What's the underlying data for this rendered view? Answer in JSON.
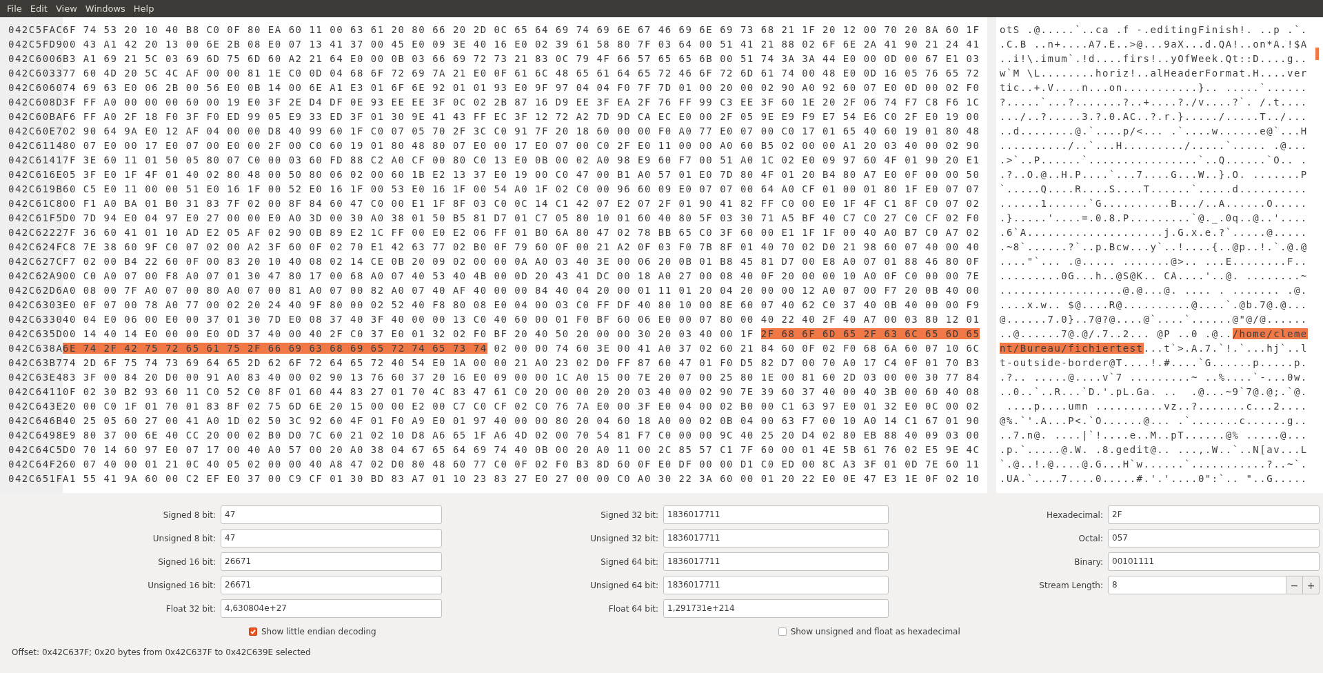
{
  "menu": [
    "File",
    "Edit",
    "View",
    "Windows",
    "Help"
  ],
  "rows": [
    {
      "offset": "042C5FAC",
      "hex": [
        {
          "text": "6F 74 53 20 10 40 B8 C0 0F 80 EA 60 11 00 63 61 20 80 66 20 2D 0C 65 64 69 74 69 6E 67 46 69 6E 69 73 68 21 1F 20 12 00 70 20 8A 60 1F",
          "selected": false
        }
      ],
      "ascii": [
        {
          "text": "otS .@.....`..ca .f -.editingFinish!. ..p .`.",
          "selected": false
        }
      ]
    },
    {
      "offset": "042C5FD9",
      "hex": [
        {
          "text": "00 43 A1 42 20 13 00 6E 2B 08 E0 07 13 41 37 00 45 E0 09 3E 40 16 E0 02 39 61 58 80 7F 03 64 00 51 41 21 88 02 6F 6E 2A 41 90 21 24 41",
          "selected": false
        }
      ],
      "ascii": [
        {
          "text": ".C.B ..n+....A7.E..>@...9aX...d.QA!..on*A.!$A",
          "selected": false
        }
      ]
    },
    {
      "offset": "042C6006",
      "hex": [
        {
          "text": "B3 A1 69 21 5C 03 69 6D 75 6D 60 A2 21 64 E0 00 0B 03 66 69 72 73 21 83 0C 79 4F 66 57 65 65 6B 00 51 74 3A 3A 44 E0 00 0D 00 67 E1 03",
          "selected": false
        }
      ],
      "ascii": [
        {
          "text": "..i!\\.imum`.!d....firs!..yOfWeek.Qt::D....g..",
          "selected": false
        }
      ]
    },
    {
      "offset": "042C6033",
      "hex": [
        {
          "text": "77 60 4D 20 5C 4C AF 00 00 81 1E C0 0D 04 68 6F 72 69 7A 21 E0 0F 61 6C 48 65 61 64 65 72 46 6F 72 6D 61 74 00 48 E0 0D 16 05 76 65 72",
          "selected": false
        }
      ],
      "ascii": [
        {
          "text": "w`M \\L........horiz!..alHeaderFormat.H....ver",
          "selected": false
        }
      ]
    },
    {
      "offset": "042C6060",
      "hex": [
        {
          "text": "74 69 63 E0 06 2B 00 56 E0 0B 14 00 6E A1 E3 01 6F 6E 92 01 01 93 E0 9F 97 04 04 F0 7F 7D 01 00 20 00 02 90 A0 92 60 07 E0 0D 00 02 F0",
          "selected": false
        }
      ],
      "ascii": [
        {
          "text": "tic..+.V....n...on...........}.. .....`......",
          "selected": false
        }
      ]
    },
    {
      "offset": "042C608D",
      "hex": [
        {
          "text": "3F FF A0 00 00 00 60 00 19 E0 3F 2E D4 DF 0E 93 EE EE 3F 0C 02 2B 87 16 D9 EE 3F EA 2F 76 FF 99 C3 EE 3F 60 1E 20 2F 06 74 F7 C8 F6 1C",
          "selected": false
        }
      ],
      "ascii": [
        {
          "text": "?.....`...?.......?..+....?./v....?`. /.t....",
          "selected": false
        }
      ]
    },
    {
      "offset": "042C60BA",
      "hex": [
        {
          "text": "F6 FF A0 2F 18 F0 3F F0 ED 99 05 E9 33 ED 3F 01 30 9E 41 43 FF EC 3F 12 72 A2 7D 9D CA EC E0 00 2F 05 9E E9 F9 E7 54 E6 C0 2F E0 19 00",
          "selected": false
        }
      ],
      "ascii": [
        {
          "text": ".../..?.....3.?.0.AC..?.r.}...../.....T../...",
          "selected": false
        }
      ]
    },
    {
      "offset": "042C60E7",
      "hex": [
        {
          "text": "02 90 64 9A E0 12 AF 04 00 00 D8 40 99 60 1F C0 07 05 70 2F 3C C0 91 7F 20 18 60 00 00 F0 A0 77 E0 07 00 C0 17 01 65 40 60 19 01 80 48",
          "selected": false
        }
      ],
      "ascii": [
        {
          "text": "..d........@.`....p/<... .`....w......e@`...H",
          "selected": false
        }
      ]
    },
    {
      "offset": "042C6114",
      "hex": [
        {
          "text": "80 07 E0 00 17 E0 07 00 E0 00 2F 00 C0 60 19 01 80 48 80 07 E0 00 17 E0 07 00 C0 2F E0 11 00 00 A0 60 B5 02 00 00 A1 20 03 40 00 02 90",
          "selected": false
        }
      ],
      "ascii": [
        {
          "text": "........../..`...H........./.....`..... .@...",
          "selected": false
        }
      ]
    },
    {
      "offset": "042C6141",
      "hex": [
        {
          "text": "7F 3E 60 11 01 50 05 80 07 C0 00 03 60 FD 88 C2 A0 CF 00 80 C0 13 E0 0B 00 02 A0 98 E9 60 F7 00 51 A0 1C 02 E0 09 97 60 4F 01 90 20 E1",
          "selected": false
        }
      ],
      "ascii": [
        {
          "text": ".>`..P......`................`..Q......`O.. .",
          "selected": false
        }
      ]
    },
    {
      "offset": "042C616E",
      "hex": [
        {
          "text": "05 3F E0 1F 4F 01 40 02 80 48 00 50 80 06 02 00 60 1B E2 13 37 E0 19 00 C0 47 00 B1 A0 57 01 E0 7D 80 4F 01 20 B4 80 A7 E0 0F 00 00 50",
          "selected": false
        }
      ],
      "ascii": [
        {
          "text": ".?..O.@..H.P....`...7....G...W..}.O. .......P",
          "selected": false
        }
      ]
    },
    {
      "offset": "042C619B",
      "hex": [
        {
          "text": "60 C5 E0 11 00 00 51 E0 16 1F 00 52 E0 16 1F 00 53 E0 16 1F 00 54 A0 1F 02 C0 00 96 60 09 E0 07 07 00 64 A0 CF 01 00 01 80 1F E0 07 07",
          "selected": false
        }
      ],
      "ascii": [
        {
          "text": "`.....Q....R....S....T......`.....d..........",
          "selected": false
        }
      ]
    },
    {
      "offset": "042C61C8",
      "hex": [
        {
          "text": "00 F1 A0 BA 01 B0 31 83 7F 02 00 8F 84 60 47 C0 00 E1 1F 8F 03 C0 0C 14 C1 42 07 E2 07 2F 01 90 41 82 FF C0 00 E0 1F 4F C1 8F C0 07 02",
          "selected": false
        }
      ],
      "ascii": [
        {
          "text": "......1......`G..........B.../..A......O.....",
          "selected": false
        }
      ]
    },
    {
      "offset": "042C61F5",
      "hex": [
        {
          "text": "D0 7D 94 E0 04 97 E0 27 00 00 E0 A0 3D 00 30 A0 38 01 50 B5 81 D7 01 C7 05 80 10 01 60 40 80 5F 03 30 71 A5 BF 40 C7 C0 27 C0 CF 02 F0",
          "selected": false
        }
      ],
      "ascii": [
        {
          "text": ".}.....'....=.0.8.P.........`@._.0q..@..'....",
          "selected": false
        }
      ]
    },
    {
      "offset": "042C6222",
      "hex": [
        {
          "text": "7F 36 60 41 01 10 AD E2 05 AF 02 90 0B 89 E2 1C FF 00 E0 E2 06 FF 01 B0 6A 80 47 02 78 BB 65 C0 3F 60 00 E1 1F 1F 00 40 A0 B7 C0 A7 02",
          "selected": false
        }
      ],
      "ascii": [
        {
          "text": ".6`A....................j.G.x.e.?`.....@.....",
          "selected": false
        }
      ]
    },
    {
      "offset": "042C624F",
      "hex": [
        {
          "text": "C8 7E 38 60 9F C0 07 02 00 A2 3F 60 0F 02 70 E1 42 63 77 02 B0 0F 79 60 0F 00 21 A2 0F 03 F0 7B 8F 01 40 70 02 D0 21 98 60 07 40 00 40",
          "selected": false
        }
      ],
      "ascii": [
        {
          "text": ".~8`......?`..p.Bcw...y`..!....{..@p..!.`.@.@",
          "selected": false
        }
      ]
    },
    {
      "offset": "042C627C",
      "hex": [
        {
          "text": "F7 02 00 B4 22 60 0F 00 83 20 10 40 08 02 14 CE 0B 20 09 02 00 00 0A A0 03 40 3E 00 06 20 0B 01 B8 45 81 D7 00 E8 A0 07 01 88 46 80 0F",
          "selected": false
        }
      ],
      "ascii": [
        {
          "text": "....\"`... .@..... .......@>.. ...E........F..",
          "selected": false
        }
      ]
    },
    {
      "offset": "042C62A9",
      "hex": [
        {
          "text": "00 C0 A0 07 00 F8 A0 07 01 30 47 80 17 00 68 A0 07 40 53 40 4B 00 0D 20 43 41 DC 00 18 A0 27 00 08 40 0F 20 00 00 10 A0 0F C0 00 00 7E",
          "selected": false
        }
      ],
      "ascii": [
        {
          "text": ".........0G...h..@S@K.. CA....'..@. ........~",
          "selected": false
        }
      ]
    },
    {
      "offset": "042C62D6",
      "hex": [
        {
          "text": "A0 08 00 7F A0 07 00 80 A0 07 00 81 A0 07 00 82 A0 07 40 AF 40 00 00 84 40 04 20 00 01 11 01 20 04 20 00 00 12 A0 07 00 F7 20 0B 40 00",
          "selected": false
        }
      ],
      "ascii": [
        {
          "text": "..................@.@...@. .... . ....... .@.",
          "selected": false
        }
      ]
    },
    {
      "offset": "042C6303",
      "hex": [
        {
          "text": "E0 0F 07 00 78 A0 77 00 02 20 24 40 9F 80 00 02 52 40 F8 80 08 E0 04 00 03 C0 FF DF 40 80 10 00 8E 60 07 40 62 C0 37 40 0B 40 00 00 F9",
          "selected": false
        }
      ],
      "ascii": [
        {
          "text": "....x.w.. $@....R@..........@....`.@b.7@.@...",
          "selected": false
        }
      ]
    },
    {
      "offset": "042C6330",
      "hex": [
        {
          "text": "40 04 E0 06 00 E0 00 37 01 30 7D E0 08 37 40 3F 40 00 00 13 C0 40 60 00 01 F0 BF 60 06 E0 00 07 80 00 40 22 40 2F 40 A7 00 03 80 12 01",
          "selected": false
        }
      ],
      "ascii": [
        {
          "text": "@......7.0}..7@?@....@`....`......@\"@/@......",
          "selected": false
        }
      ]
    },
    {
      "offset": "042C635D",
      "hex": [
        {
          "text": "00 14 40 14 E0 00 00 E0 0D 37 40 00 40 2F C0 37 E0 01 32 02 F0 BF 20 40 50 20 00 00 30 20 03 40 00 1F",
          "selected": false
        },
        {
          "text": "2F 68 6F 6D 65 2F 63 6C 65 6D 65",
          "selected": true
        }
      ],
      "ascii": [
        {
          "text": "..@......7@.@/.7..2... @P ..0 .@..",
          "selected": false
        },
        {
          "text": "/home/cleme",
          "selected": true
        }
      ]
    },
    {
      "offset": "042C638A",
      "hex": [
        {
          "text": "6E 74 2F 42 75 72 65 61 75 2F 66 69 63 68 69 65 72 74 65 73 74",
          "selected": true
        },
        {
          "text": "02 00 00 74 60 3E 00 41 A0 37 02 60 21 84 60 0F 02 F0 68 6A 60 07 10 6C",
          "selected": false
        }
      ],
      "ascii": [
        {
          "text": "nt/Bureau/fichiertest",
          "selected": true
        },
        {
          "text": "...t`>.A.7.`!.`...hj`..l",
          "selected": false
        }
      ]
    },
    {
      "offset": "042C63B7",
      "hex": [
        {
          "text": "74 2D 6F 75 74 73 69 64 65 2D 62 6F 72 64 65 72 40 54 E0 1A 00 00 21 A0 23 02 D0 FF 87 60 47 01 F0 D5 82 D7 00 70 A0 17 C4 0F 01 70 B3",
          "selected": false
        }
      ],
      "ascii": [
        {
          "text": "t-outside-border@T....!.#....`G......p.....p.",
          "selected": false
        }
      ]
    },
    {
      "offset": "042C63E4",
      "hex": [
        {
          "text": "83 3F 00 84 20 D0 00 91 A0 83 40 00 02 90 13 76 60 37 20 16 E0 09 00 00 1C A0 15 00 7E 20 07 00 25 80 1E 00 81 60 2D 03 00 00 30 77 84",
          "selected": false
        }
      ],
      "ascii": [
        {
          "text": ".?.. .....@....v`7 .........~ ..%....`-...0w.",
          "selected": false
        }
      ]
    },
    {
      "offset": "042C6411",
      "hex": [
        {
          "text": "0F 02 30 B2 93 60 11 C0 52 C0 8F 01 60 44 83 27 01 70 4C 83 47 61 C0 20 00 00 20 20 03 40 00 02 90 7E 39 60 37 40 00 40 3B 00 60 40 08",
          "selected": false
        }
      ],
      "ascii": [
        {
          "text": "..0..`..R...`D.'.pL.Ga. ..  .@...~9`7@.@;.`@.",
          "selected": false
        }
      ]
    },
    {
      "offset": "042C643E",
      "hex": [
        {
          "text": "20 00 C0 1F 01 70 01 83 8F 02 75 6D 6E 20 15 00 00 E2 00 C7 C0 CF 02 C0 76 7A E0 00 3F E0 04 00 02 B0 00 C1 63 97 E0 01 32 E0 0C 00 02",
          "selected": false
        }
      ],
      "ascii": [
        {
          "text": " ....p....umn ..........vz..?.......c...2....",
          "selected": false
        }
      ]
    },
    {
      "offset": "042C646B",
      "hex": [
        {
          "text": "40 25 05 60 27 00 41 A0 1D 02 50 3C 92 60 4F 01 F0 A9 E0 01 97 40 00 00 80 20 04 60 18 A0 00 02 0B 04 00 63 F7 00 10 A0 14 C1 67 01 90",
          "selected": false
        }
      ],
      "ascii": [
        {
          "text": "@%.`'.A...P<.`O......@... .`.......c......g..",
          "selected": false
        }
      ]
    },
    {
      "offset": "042C6498",
      "hex": [
        {
          "text": "E9 80 37 00 6E 40 CC 20 00 02 B0 D0 7C 60 21 02 10 D8 A6 65 1F A6 4D 02 00 70 54 81 F7 C0 00 00 9C 40 25 20 D4 02 80 EB 88 40 09 03 00",
          "selected": false
        }
      ],
      "ascii": [
        {
          "text": "..7.n@. ....|`!....e..M..pT......@% .....@...",
          "selected": false
        }
      ]
    },
    {
      "offset": "042C64C5",
      "hex": [
        {
          "text": "D0 70 14 60 97 E0 07 17 00 40 A0 57 00 20 A0 38 04 67 65 64 69 74 40 0B 00 20 A0 11 00 2C 85 57 C1 7F 60 00 01 4E 5B 61 76 02 E5 9E 4C",
          "selected": false
        }
      ],
      "ascii": [
        {
          "text": ".p.`.....@.W. .8.gedit@.. ...,.W..`..N[av...L",
          "selected": false
        }
      ]
    },
    {
      "offset": "042C64F2",
      "hex": [
        {
          "text": "60 07 40 00 01 21 0C 40 05 02 00 00 40 A8 47 02 D0 80 48 60 77 C0 0F 02 F0 B3 8D 60 0F E0 DF 00 00 D1 C0 ED 00 8C A3 3F 01 0D 7E 60 11",
          "selected": false
        }
      ],
      "ascii": [
        {
          "text": "`.@..!.@....@.G...H`w......`...........?..~`.",
          "selected": false
        }
      ]
    },
    {
      "offset": "042C651F",
      "hex": [
        {
          "text": "A1 55 41 9A 60 00 C2 EF E0 37 00 C9 CF 01 30 BD 83 A7 01 10 23 83 27 E0 27 00 00 C0 A0 30 22 3A 60 00 01 20 22 E0 0E 47 E3 1E 0F 02 10",
          "selected": false
        }
      ],
      "ascii": [
        {
          "text": ".UA.`....7....0.....#.'.'....0\":`.. \"..G.....",
          "selected": false
        }
      ]
    }
  ],
  "converters": [
    [
      {
        "label": "Signed 8 bit:",
        "value": "47",
        "kind": "text"
      },
      {
        "label": "Unsigned 8 bit:",
        "value": "47",
        "kind": "text"
      },
      {
        "label": "Signed 16 bit:",
        "value": "26671",
        "kind": "text"
      },
      {
        "label": "Unsigned 16 bit:",
        "value": "26671",
        "kind": "text"
      },
      {
        "label": "Float 32 bit:",
        "value": "4,630804e+27",
        "kind": "text"
      }
    ],
    [
      {
        "label": "Signed 32 bit:",
        "value": "1836017711",
        "kind": "text"
      },
      {
        "label": "Unsigned 32 bit:",
        "value": "1836017711",
        "kind": "text"
      },
      {
        "label": "Signed 64 bit:",
        "value": "1836017711",
        "kind": "text"
      },
      {
        "label": "Unsigned 64 bit:",
        "value": "1836017711",
        "kind": "text"
      },
      {
        "label": "Float 64 bit:",
        "value": "1,291731e+214",
        "kind": "text"
      }
    ],
    [
      {
        "label": "Hexadecimal:",
        "value": "2F",
        "kind": "text"
      },
      {
        "label": "Octal:",
        "value": "057",
        "kind": "text"
      },
      {
        "label": "Binary:",
        "value": "00101111",
        "kind": "text"
      },
      {
        "label": "Stream Length:",
        "value": "8",
        "kind": "spin",
        "decrement": "−",
        "increment": "+"
      }
    ]
  ],
  "options": [
    {
      "label": "Show little endian decoding",
      "checked": true
    },
    {
      "label": "Show unsigned and float as hexadecimal",
      "checked": false
    }
  ],
  "status": "Offset: 0x42C637F; 0x20 bytes from 0x42C637F to 0x42C639E selected"
}
